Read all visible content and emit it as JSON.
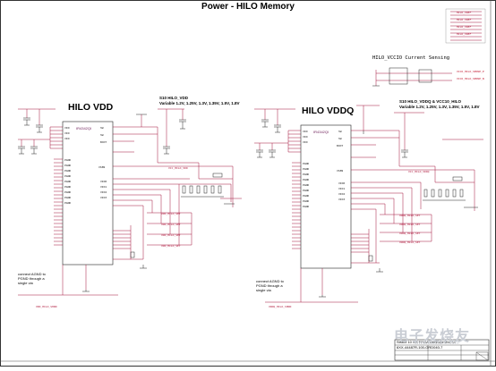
{
  "title": "Power - HILO Memory",
  "vcc_sense": {
    "title": "HILO_VCCIO Current Sensing",
    "net_labels": [
      "VCCO_HILO_SENSE_P",
      "VCCO_HILO_SENSE_N"
    ]
  },
  "left": {
    "heading": "HILO VDD",
    "chip_label": "IR4342QI",
    "note_title": "S10 HILO_VDD",
    "note_values": "Variable 1.2V, 1.25V, 1.3V, 1.35V, 1.5V, 1.8V",
    "comment": [
      "connect AGND to",
      "PGND through a",
      "single via"
    ]
  },
  "right": {
    "heading": "HILO VDDQ",
    "chip_label": "IR4342QI",
    "note_title": "S10 HILO_VDDQ & VCC10_HILO",
    "note_values": "Variable 1.2V, 1.25V, 1.3V, 1.35V, 1.5V, 1.8V",
    "comment": [
      "connect AGND to",
      "PGND through a",
      "single via"
    ]
  },
  "title_block": {
    "line1": "Stratix 10 GX FPGA Development Kit",
    "line2": "6XX-44487R-100-GRD040-7"
  },
  "watermark": {
    "text": "电子发烧友",
    "sub": "www.elecfans.com"
  },
  "colors": {
    "wire": "#a1123a",
    "ink": "#1b1b1b",
    "grid": "#aaaaaa"
  }
}
